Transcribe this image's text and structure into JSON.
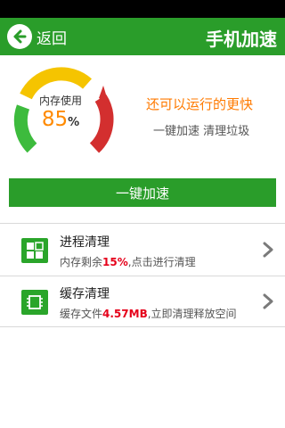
{
  "header": {
    "back_label": "返回",
    "title": "手机加速"
  },
  "gauge": {
    "label": "内存使用",
    "value": "85",
    "unit": "%",
    "level": 0.85
  },
  "hint": {
    "title": "还可以运行的更快",
    "subtitle": "一键加速 清理垃圾"
  },
  "speedup_button": "一键加速",
  "items": [
    {
      "title": "进程清理",
      "desc_prefix": "内存剩余",
      "desc_highlight": "15%",
      "desc_suffix": ",点击进行清理",
      "icon": "process-grid-icon"
    },
    {
      "title": "缓存清理",
      "desc_prefix": "缓存文件",
      "desc_highlight": "4.57MB",
      "desc_suffix": ",立即清理释放空间",
      "icon": "chip-icon"
    }
  ],
  "colors": {
    "primary_green": "#2a9d2a",
    "accent_orange": "#ff7a00",
    "highlight_red": "#e5001a",
    "gauge_yellow": "#f5c400",
    "gauge_red": "#d32f2f"
  }
}
